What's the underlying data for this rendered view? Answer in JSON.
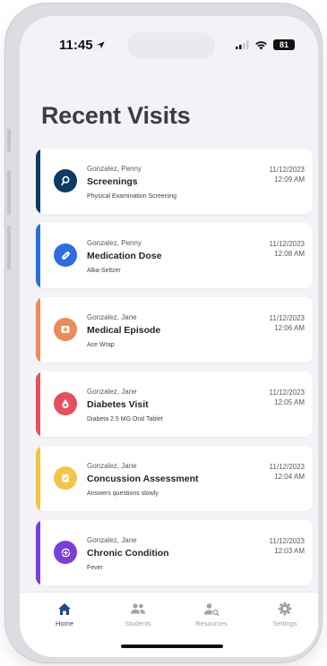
{
  "status_bar": {
    "time": "11:45",
    "battery": "81"
  },
  "page_title": "Recent Visits",
  "visits": [
    {
      "patient": "Gonzalez, Penny",
      "type": "Screenings",
      "detail": "Physical Examination Screening",
      "date": "11/12/2023",
      "time": "12:09 AM",
      "color": "#0d3b66",
      "icon": "screening-icon"
    },
    {
      "patient": "Gonzalez, Penny",
      "type": "Medication Dose",
      "detail": "Alka-Seltzer",
      "date": "11/12/2023",
      "time": "12:08 AM",
      "color": "#2d6ddf",
      "icon": "pill-icon"
    },
    {
      "patient": "Gonzalez, Jane",
      "type": "Medical Episode",
      "detail": "Ace Wrap",
      "date": "11/12/2023",
      "time": "12:06 AM",
      "color": "#ee8a57",
      "icon": "medical-cross-icon"
    },
    {
      "patient": "Gonzalez, Jane",
      "type": "Diabetes Visit",
      "detail": "Diabeta 2.5 MG Oral Tablet",
      "date": "11/12/2023",
      "time": "12:05 AM",
      "color": "#e5505c",
      "icon": "blood-drop-icon"
    },
    {
      "patient": "Gonzalez, Jane",
      "type": "Concussion Assessment",
      "detail": "Answers questions slowly",
      "date": "11/12/2023",
      "time": "12:04 AM",
      "color": "#f6c443",
      "icon": "clipboard-icon"
    },
    {
      "patient": "Gonzalez, Jane",
      "type": "Chronic Condition",
      "detail": "Fever",
      "date": "11/12/2023",
      "time": "12:03 AM",
      "color": "#7a3fd6",
      "icon": "chronic-icon"
    }
  ],
  "tabs": [
    {
      "label": "Home",
      "icon": "home-icon",
      "active": true
    },
    {
      "label": "Students",
      "icon": "students-icon",
      "active": false
    },
    {
      "label": "Resources",
      "icon": "resources-icon",
      "active": false
    },
    {
      "label": "Settings",
      "icon": "gear-icon",
      "active": false
    }
  ],
  "colors": {
    "active_tab": "#1e4a8a",
    "inactive_tab": "#a0a2a8",
    "background": "#f2f2f7"
  }
}
